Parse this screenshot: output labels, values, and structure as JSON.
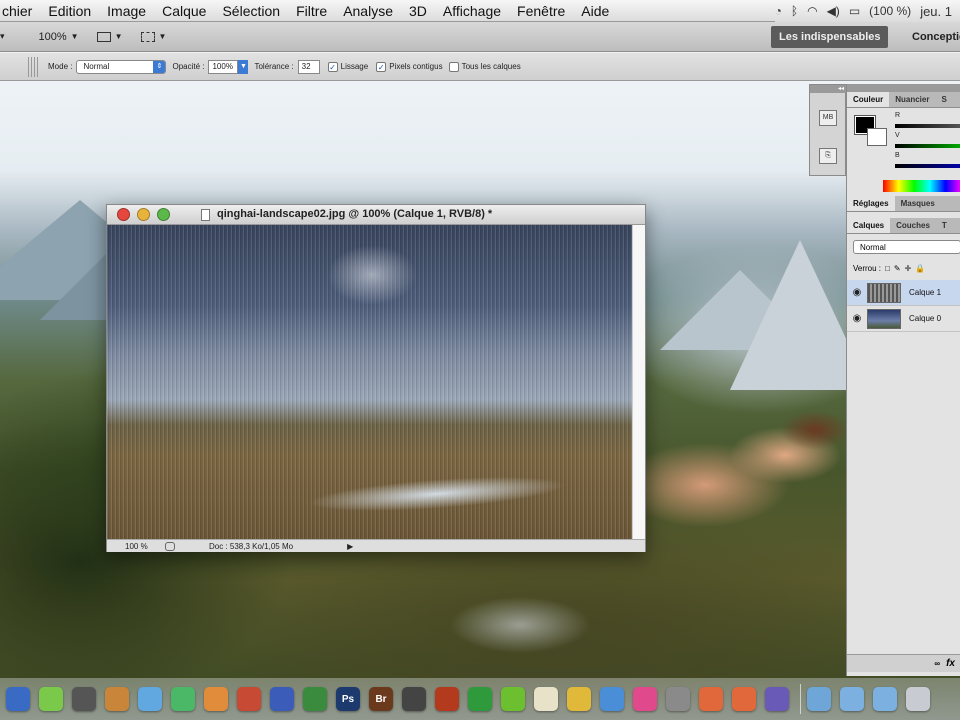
{
  "menubar": {
    "items": [
      "chier",
      "Edition",
      "Image",
      "Calque",
      "Sélection",
      "Filtre",
      "Analyse",
      "3D",
      "Affichage",
      "Fenêtre",
      "Aide"
    ],
    "battery": "(100 %)",
    "clock": "jeu. 1"
  },
  "appbar": {
    "zoom": "100%",
    "workspace_active": "Les indispensables",
    "workspace_other": "Conceptio"
  },
  "options": {
    "mode_label": "Mode :",
    "mode_value": "Normal",
    "opacity_label": "Opacité :",
    "opacity_value": "100%",
    "tolerance_label": "Tolérance :",
    "tolerance_value": "32",
    "lissage_label": "Lissage",
    "lissage_checked": true,
    "contigus_label": "Pixels contigus",
    "contigus_checked": true,
    "tous_label": "Tous les calques",
    "tous_checked": false
  },
  "document": {
    "title": "qinghai-landscape02.jpg @ 100% (Calque 1, RVB/8) *",
    "zoom": "100 %",
    "doc_info": "Doc : 538,3 Ko/1,05 Mo"
  },
  "toolstrip": {
    "mini_label": "MB"
  },
  "panels": {
    "color_tabs": [
      "Couleur",
      "Nuancier",
      "S"
    ],
    "rgb_labels": [
      "R",
      "V",
      "B"
    ],
    "adjust_tabs": [
      "Réglages",
      "Masques"
    ],
    "layer_tabs": [
      "Calques",
      "Couches",
      "T"
    ],
    "blend_mode": "Normal",
    "lock_label": "Verrou :",
    "lock_icons": [
      "□",
      "✎",
      "✛",
      "🔒"
    ],
    "layers": [
      {
        "name": "Calque 1",
        "selected": true
      },
      {
        "name": "Calque 0",
        "selected": false
      }
    ],
    "fx_label": "fx"
  },
  "dock": {
    "apps": [
      {
        "name": "stack",
        "label": "",
        "color": "#3a6bc4"
      },
      {
        "name": "system",
        "label": "",
        "color": "#7ac94a"
      },
      {
        "name": "photo-booth",
        "label": "",
        "color": "#555"
      },
      {
        "name": "garageband",
        "label": "",
        "color": "#c9863a"
      },
      {
        "name": "app-blue",
        "label": "",
        "color": "#62a8e0"
      },
      {
        "name": "app-green",
        "label": "",
        "color": "#4ab867"
      },
      {
        "name": "app-orange",
        "label": "",
        "color": "#e08c3a"
      },
      {
        "name": "app-red",
        "label": "",
        "color": "#c64a34"
      },
      {
        "name": "pen",
        "label": "",
        "color": "#3b5cb8"
      },
      {
        "name": "charts",
        "label": "",
        "color": "#3b8b3f"
      },
      {
        "name": "photoshop",
        "label": "Ps",
        "color": "#1c3a6e"
      },
      {
        "name": "bridge",
        "label": "Br",
        "color": "#6b3a1c"
      },
      {
        "name": "app-dark",
        "label": "",
        "color": "#444"
      },
      {
        "name": "flash",
        "label": "",
        "color": "#b33a1c"
      },
      {
        "name": "itunes",
        "label": "",
        "color": "#2f9a3b"
      },
      {
        "name": "spotify",
        "label": "",
        "color": "#6cbf2f"
      },
      {
        "name": "notes",
        "label": "",
        "color": "#e8e2c8"
      },
      {
        "name": "app-bird",
        "label": "",
        "color": "#e0b83a"
      },
      {
        "name": "safari",
        "label": "",
        "color": "#4a8ed8"
      },
      {
        "name": "app-pink",
        "label": "",
        "color": "#e04a8c"
      },
      {
        "name": "app-gray",
        "label": "",
        "color": "#8a8a8a"
      },
      {
        "name": "firefox-1",
        "label": "",
        "color": "#e0683a"
      },
      {
        "name": "firefox-2",
        "label": "",
        "color": "#e0683a"
      },
      {
        "name": "app-movie",
        "label": "",
        "color": "#6a5ab8"
      }
    ],
    "right_items": [
      {
        "name": "folder-1",
        "color": "#6fa6d8"
      },
      {
        "name": "folder-2",
        "color": "#7bb0e0"
      },
      {
        "name": "folder-3",
        "color": "#7bb0e0"
      },
      {
        "name": "trash",
        "color": "#c8ccd2"
      }
    ]
  }
}
